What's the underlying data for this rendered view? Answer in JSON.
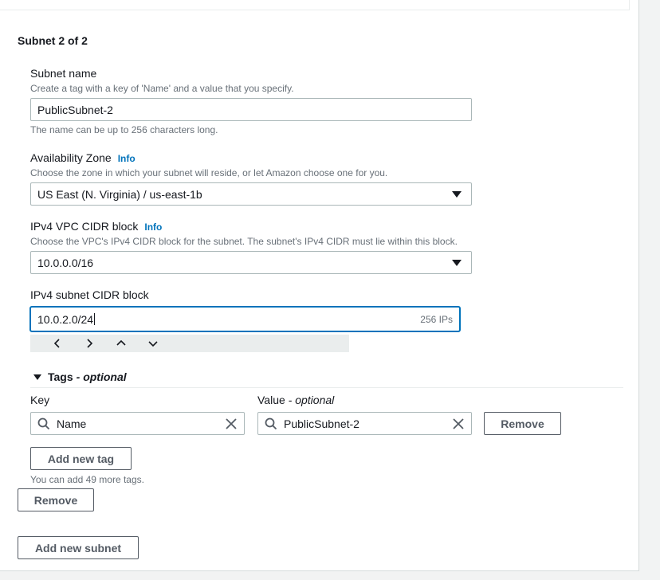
{
  "section": {
    "title": "Subnet 2 of 2"
  },
  "subnet_name": {
    "label": "Subnet name",
    "description": "Create a tag with a key of 'Name' and a value that you specify.",
    "value": "PublicSubnet-2",
    "constraint": "The name can be up to 256 characters long."
  },
  "availability_zone": {
    "label": "Availability Zone",
    "info": "Info",
    "description": "Choose the zone in which your subnet will reside, or let Amazon choose one for you.",
    "selected": "US East (N. Virginia) / us-east-1b"
  },
  "vpc_cidr": {
    "label": "IPv4 VPC CIDR block",
    "info": "Info",
    "description": "Choose the VPC's IPv4 CIDR block for the subnet. The subnet's IPv4 CIDR must lie within this block.",
    "selected": "10.0.0.0/16"
  },
  "subnet_cidr": {
    "label": "IPv4 subnet CIDR block",
    "value": "10.0.2.0/24",
    "ip_count": "256 IPs",
    "stepper_icons": [
      "chevron-left-icon",
      "chevron-right-icon",
      "chevron-up-icon",
      "chevron-down-icon"
    ]
  },
  "tags": {
    "title": "Tags",
    "title_suffix": "- optional",
    "key_label": "Key",
    "value_label": "Value",
    "value_label_suffix": "- optional",
    "rows": [
      {
        "key": "Name",
        "value": "PublicSubnet-2",
        "remove_label": "Remove"
      }
    ],
    "add_label": "Add new tag",
    "remaining_note": "You can add 49 more tags."
  },
  "actions": {
    "remove_subnet_label": "Remove",
    "add_subnet_label": "Add new subnet"
  },
  "colors": {
    "accent": "#0073bb",
    "text": "#16191f",
    "muted": "#687078",
    "border": "#aab7b8",
    "background": "#f2f3f3"
  }
}
